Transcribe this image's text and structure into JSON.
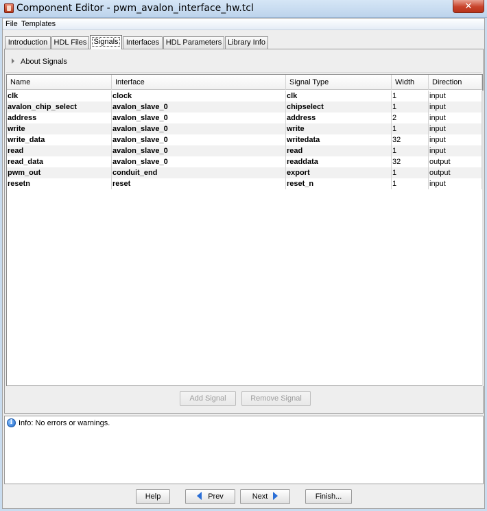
{
  "window": {
    "title": "Component Editor - pwm_avalon_interface_hw.tcl",
    "close_label": "✕"
  },
  "menu": {
    "file": "File",
    "templates": "Templates"
  },
  "tabs": [
    "Introduction",
    "HDL Files",
    "Signals",
    "Interfaces",
    "HDL Parameters",
    "Library Info"
  ],
  "active_tab": "Signals",
  "about_label": "About Signals",
  "table": {
    "headers": [
      "Name",
      "Interface",
      "Signal Type",
      "Width",
      "Direction"
    ],
    "rows": [
      [
        "clk",
        "clock",
        "clk",
        "1",
        "input"
      ],
      [
        "avalon_chip_select",
        "avalon_slave_0",
        "chipselect",
        "1",
        "input"
      ],
      [
        "address",
        "avalon_slave_0",
        "address",
        "2",
        "input"
      ],
      [
        "write",
        "avalon_slave_0",
        "write",
        "1",
        "input"
      ],
      [
        "write_data",
        "avalon_slave_0",
        "writedata",
        "32",
        "input"
      ],
      [
        "read",
        "avalon_slave_0",
        "read",
        "1",
        "input"
      ],
      [
        "read_data",
        "avalon_slave_0",
        "readdata",
        "32",
        "output"
      ],
      [
        "pwm_out",
        "conduit_end",
        "export",
        "1",
        "output"
      ],
      [
        "resetn",
        "reset",
        "reset_n",
        "1",
        "input"
      ]
    ]
  },
  "buttons": {
    "add_signal": "Add Signal",
    "remove_signal": "Remove Signal"
  },
  "messages": {
    "info": "Info: No errors or warnings."
  },
  "footer": {
    "help": "Help",
    "prev": "Prev",
    "next": "Next",
    "finish": "Finish..."
  },
  "colors": {
    "accent": "#2a6ed6",
    "titlebar": "#c9dcef",
    "close": "#c8432b"
  }
}
